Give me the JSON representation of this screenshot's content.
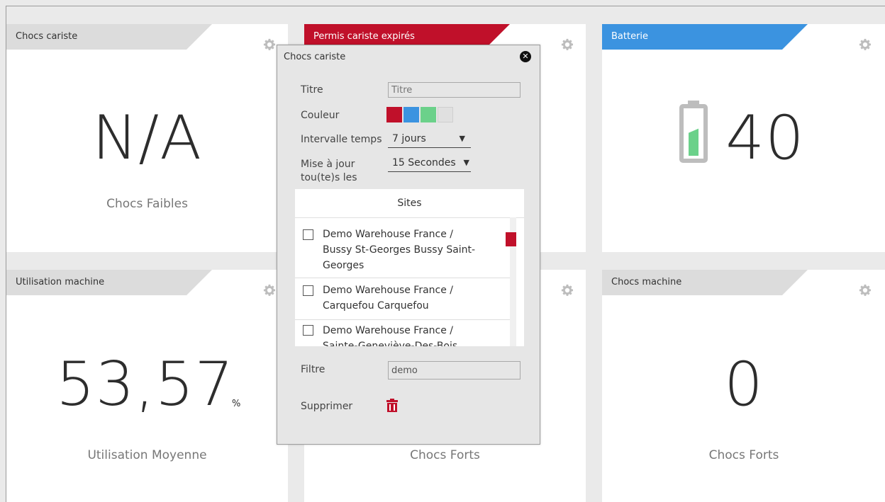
{
  "colors": {
    "red": "#c0102a",
    "blue": "#3b93e0",
    "green": "#6bd18a",
    "grey": "#e0e0e0",
    "title_grey": "#dcdcdc"
  },
  "cards": {
    "chocs_cariste": {
      "title": "Chocs cariste",
      "value": "N/A",
      "label": "Chocs Faibles"
    },
    "permis": {
      "title": "Permis cariste expirés"
    },
    "batterie": {
      "title": "Batterie",
      "value": "40",
      "level_percent": 60
    },
    "utilisation": {
      "title": "Utilisation machine",
      "value": "53,57",
      "unit": "%",
      "label": "Utilisation Moyenne"
    },
    "middle_bottom": {
      "label": "Chocs Forts"
    },
    "chocs_machine": {
      "title": "Chocs machine",
      "value": "0",
      "label": "Chocs Forts"
    }
  },
  "popup": {
    "title": "Chocs cariste",
    "titre_label": "Titre",
    "titre_placeholder": "Titre",
    "couleur_label": "Couleur",
    "intervalle_label": "Intervalle temps",
    "intervalle_value": "7 jours",
    "maj_label_1": "Mise à jour",
    "maj_label_2": "tou(te)s les",
    "maj_value": "15 Secondes",
    "sites_header": "Sites",
    "sites": [
      {
        "line1": "Demo Warehouse France /",
        "line2": "Bussy St-Georges Bussy Saint-",
        "line3": "Georges"
      },
      {
        "line1": "Demo Warehouse France /",
        "line2": "Carquefou Carquefou"
      },
      {
        "line1": "Demo Warehouse France /",
        "line2": "Sainte-Geneviève-Des-Bois"
      }
    ],
    "filtre_label": "Filtre",
    "filtre_value": "demo",
    "supprimer_label": "Supprimer"
  }
}
